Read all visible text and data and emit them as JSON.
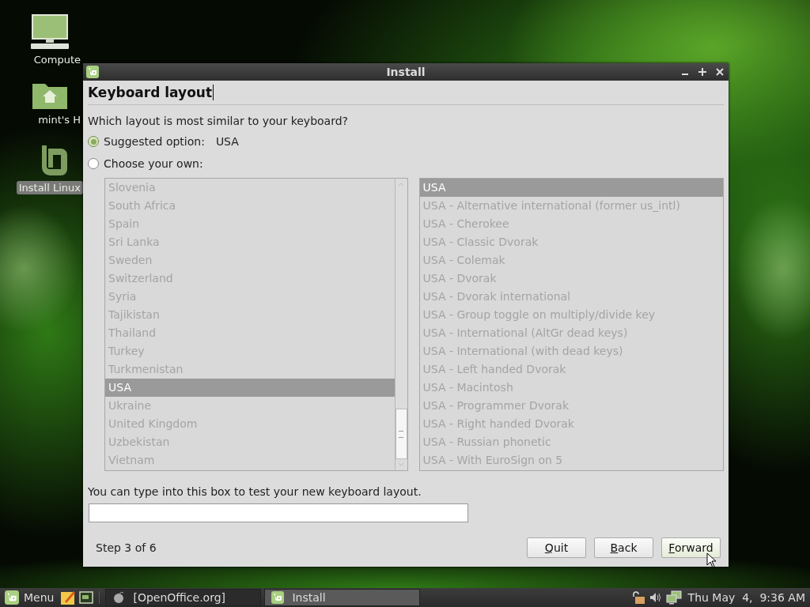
{
  "desktop": {
    "icons": [
      {
        "label": "Compute",
        "kind": "computer",
        "selected": false
      },
      {
        "label": "mint's H",
        "kind": "home",
        "selected": false
      },
      {
        "label": "Install Linux",
        "kind": "installer",
        "selected": true
      }
    ]
  },
  "window": {
    "title": "Install",
    "heading": "Keyboard layout",
    "question": "Which layout is most similar to your keyboard?",
    "options": [
      {
        "label": "Suggested option:",
        "value": "USA",
        "selected": true
      },
      {
        "label": "Choose your own:",
        "selected": false
      }
    ],
    "lists_disabled": true,
    "countries": [
      {
        "label": "Slovenia",
        "selected": false
      },
      {
        "label": "South Africa",
        "selected": false
      },
      {
        "label": "Spain",
        "selected": false
      },
      {
        "label": "Sri Lanka",
        "selected": false
      },
      {
        "label": "Sweden",
        "selected": false
      },
      {
        "label": "Switzerland",
        "selected": false
      },
      {
        "label": "Syria",
        "selected": false
      },
      {
        "label": "Tajikistan",
        "selected": false
      },
      {
        "label": "Thailand",
        "selected": false
      },
      {
        "label": "Turkey",
        "selected": false
      },
      {
        "label": "Turkmenistan",
        "selected": false
      },
      {
        "label": "USA",
        "selected": true
      },
      {
        "label": "Ukraine",
        "selected": false
      },
      {
        "label": "United Kingdom",
        "selected": false
      },
      {
        "label": "Uzbekistan",
        "selected": false
      },
      {
        "label": "Vietnam",
        "selected": false
      }
    ],
    "variants": [
      {
        "label": "USA",
        "selected": true
      },
      {
        "label": "USA - Alternative international (former us_intl)",
        "selected": false
      },
      {
        "label": "USA - Cherokee",
        "selected": false
      },
      {
        "label": "USA - Classic Dvorak",
        "selected": false
      },
      {
        "label": "USA - Colemak",
        "selected": false
      },
      {
        "label": "USA - Dvorak",
        "selected": false
      },
      {
        "label": "USA - Dvorak international",
        "selected": false
      },
      {
        "label": "USA - Group toggle on multiply/divide key",
        "selected": false
      },
      {
        "label": "USA - International (AltGr dead keys)",
        "selected": false
      },
      {
        "label": "USA - International (with dead keys)",
        "selected": false
      },
      {
        "label": "USA - Left handed Dvorak",
        "selected": false
      },
      {
        "label": "USA - Macintosh",
        "selected": false
      },
      {
        "label": "USA - Programmer Dvorak",
        "selected": false
      },
      {
        "label": "USA - Right handed Dvorak",
        "selected": false
      },
      {
        "label": "USA - Russian phonetic",
        "selected": false
      },
      {
        "label": "USA - With EuroSign on 5",
        "selected": false
      }
    ],
    "test_label": "You can type into this box to test your new keyboard layout.",
    "step": "Step 3 of 6",
    "buttons": [
      {
        "label": "Quit",
        "hovered": false
      },
      {
        "label": "Back",
        "hovered": false
      },
      {
        "label": "Forward",
        "hovered": true
      }
    ]
  },
  "taskbar": {
    "menu_label": "Menu",
    "launchers": [
      {
        "kind": "notes"
      },
      {
        "kind": "terminal"
      }
    ],
    "tasks": [
      {
        "label": "[OpenOffice.org]",
        "kind": "openoffice",
        "selected": false
      },
      {
        "label": "Install",
        "kind": "mint",
        "selected": true
      }
    ],
    "tray": [
      {
        "kind": "lock"
      },
      {
        "kind": "volume"
      },
      {
        "kind": "network"
      }
    ],
    "clock": "Thu May  4,  9:36 AM"
  }
}
